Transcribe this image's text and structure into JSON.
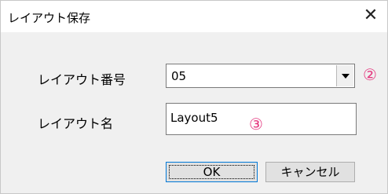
{
  "dialog": {
    "title": "レイアウト保存",
    "close_glyph": "✕",
    "layout_number": {
      "label": "レイアウト番号",
      "value": "05",
      "annotation": "②"
    },
    "layout_name": {
      "label": "レイアウト名",
      "value": "Layout5",
      "annotation": "③"
    },
    "buttons": {
      "ok": "OK",
      "cancel": "キャンセル"
    },
    "colors": {
      "annotation": "#e4387f",
      "focus_border": "#0078d7"
    }
  }
}
